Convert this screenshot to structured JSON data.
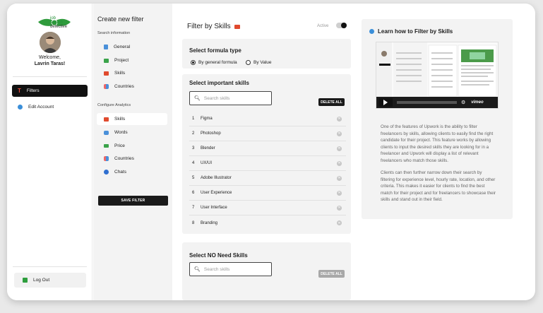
{
  "brand": {
    "logo_line1": "job",
    "logo_line2": "search",
    "logo_line3": "detective"
  },
  "user": {
    "welcome": "Welcome,",
    "name": "Lavrin Taras!"
  },
  "sidebar": {
    "items": [
      {
        "label": "Filters",
        "icon": "filter-icon",
        "active": true
      },
      {
        "label": "Edit Account",
        "icon": "globe-icon",
        "active": false
      }
    ],
    "logout_label": "Log Out"
  },
  "filter_panel": {
    "title": "Create new filter",
    "search_info_label": "Search information",
    "search_info_items": [
      {
        "label": "General",
        "icon": "document-icon"
      },
      {
        "label": "Project",
        "icon": "folder-icon"
      },
      {
        "label": "Skills",
        "icon": "briefcase-icon"
      },
      {
        "label": "Countries",
        "icon": "map-icon"
      }
    ],
    "configure_label": "Configure Analytics",
    "configure_items": [
      {
        "label": "Skills",
        "icon": "briefcase-icon",
        "active": true
      },
      {
        "label": "Words",
        "icon": "chat-icon",
        "active": false
      },
      {
        "label": "Price",
        "icon": "money-icon",
        "active": false
      },
      {
        "label": "Countries",
        "icon": "map-icon",
        "active": false
      },
      {
        "label": "Chats",
        "icon": "chats-icon",
        "active": false
      }
    ],
    "save_label": "SAVE FILTER"
  },
  "main": {
    "title": "Filter by Skills",
    "active_label": "Active",
    "active": true,
    "formula": {
      "title": "Select formula type",
      "options": [
        "By general formula",
        "By Value"
      ],
      "selected": "By general formula"
    },
    "important": {
      "title": "Select important skills",
      "search_placeholder": "Search skills",
      "delete_label": "DELETE ALL",
      "skills": [
        {
          "num": "1",
          "name": "Figma"
        },
        {
          "num": "2",
          "name": "Photoshop"
        },
        {
          "num": "3",
          "name": "Blender"
        },
        {
          "num": "4",
          "name": "UX/UI"
        },
        {
          "num": "5",
          "name": "Adobe Illustrator"
        },
        {
          "num": "6",
          "name": "User Experience"
        },
        {
          "num": "7",
          "name": "User Interface"
        },
        {
          "num": "8",
          "name": "Branding"
        }
      ]
    },
    "no_need": {
      "title": "Select NO Need Skills",
      "search_placeholder": "Search skills",
      "delete_label": "DELETE ALL"
    }
  },
  "learn": {
    "title": "Learn how to Filter by Skills",
    "video_brand": "vimeo",
    "paragraph1": "One of the features of Upwork is the ability to filter freelancers by skills, allowing clients to easily find the right candidate for their project. This feature works by allowing clients to input the desired skills they are looking for in a freelancer and Upwork will display a list of relevant freelancers who match those skills.",
    "paragraph2": "Clients can then further narrow down their search by filtering for experience level, hourly rate, location, and other criteria. This makes it easier for clients to find the best match for their project and for freelancers to showcase their skills and stand out in their field."
  },
  "colors": {
    "accent": "#111111",
    "brand_green": "#27913a",
    "panel_bg": "#f3f3f3"
  }
}
